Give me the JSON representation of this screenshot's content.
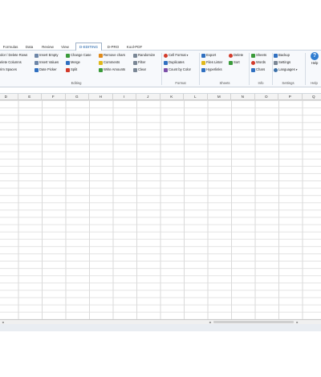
{
  "tabs": [
    {
      "label": "Formulas",
      "active": false
    },
    {
      "label": "Data",
      "active": false
    },
    {
      "label": "Review",
      "active": false
    },
    {
      "label": "View",
      "active": false
    },
    {
      "label": "D-EDITING",
      "active": true
    },
    {
      "label": "D-PRO",
      "active": false
    },
    {
      "label": "Kool-PDF",
      "active": false
    }
  ],
  "ribbon": {
    "editing": {
      "row_col_items": [
        "olor / Delete Rows",
        "elete Columns",
        "rim Spaces"
      ],
      "insert_items": [
        "Insert Empty",
        "Insert Values",
        "Date Picker"
      ],
      "change_items": [
        "Change Case",
        "Merge",
        "Split"
      ],
      "label": "Editing"
    },
    "remove": {
      "items": [
        "Remove chars",
        "Comments",
        "Write Amounts"
      ]
    },
    "random": {
      "items": [
        "Randomize",
        "Filter",
        "Clear"
      ]
    },
    "format": {
      "items": [
        "Cell Format",
        "Duplicates",
        "Count by Color"
      ],
      "label": "Format"
    },
    "sheets": {
      "export_items": [
        "Export",
        "Files Lister",
        "Hyperlinks"
      ],
      "delete_items": [
        "Delete",
        "Sort"
      ],
      "label": "Sheets"
    },
    "info": {
      "items": [
        "Sheets",
        "Words",
        "Chars"
      ],
      "label": "Info"
    },
    "settings": {
      "items": [
        "Backup",
        "Settings",
        "Languages"
      ],
      "label": "Settings"
    },
    "help": {
      "label": "Help",
      "group_label": "Help",
      "glyph": "?"
    }
  },
  "columns": [
    "D",
    "E",
    "F",
    "G",
    "H",
    "I",
    "J",
    "K",
    "L",
    "M",
    "N",
    "O",
    "P",
    "Q"
  ],
  "scroll": {
    "left_arrow": "◂",
    "right_arrow": "▸"
  },
  "icon_colors": {
    "green": "#3a9a3a",
    "blue": "#2f6fc0",
    "red": "#d23a2a",
    "orange": "#e08a1a",
    "gray": "#7a8796",
    "purple": "#7b4fa8"
  }
}
